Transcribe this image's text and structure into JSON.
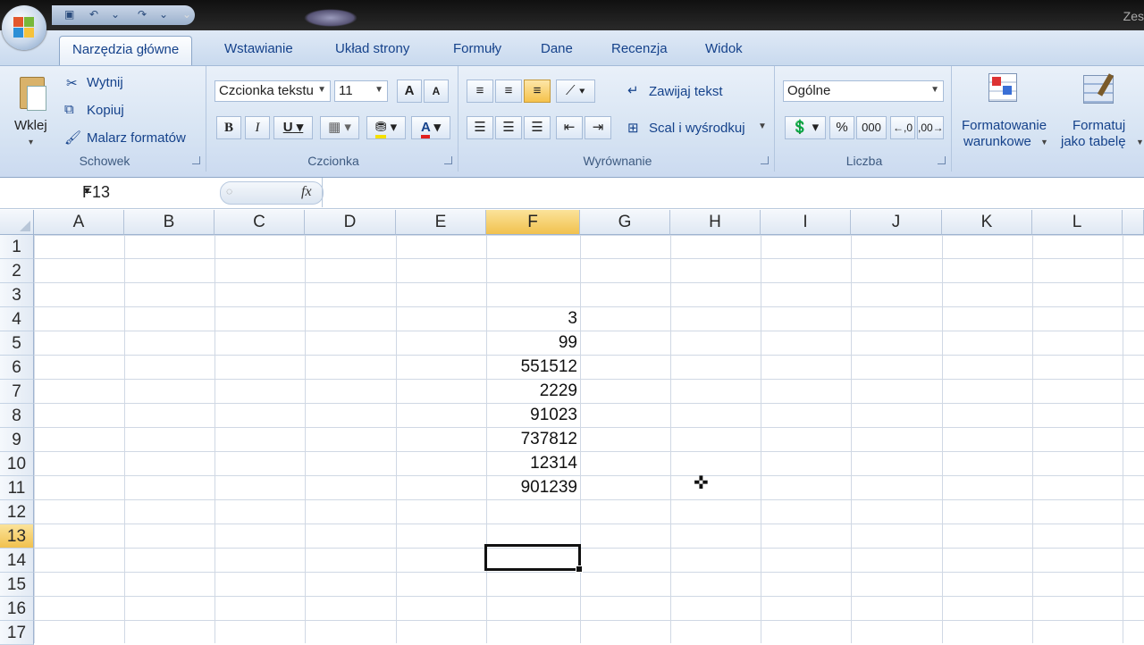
{
  "title": {
    "text": "Zes"
  },
  "tabs": [
    {
      "label": "Narzędzia główne",
      "active": true
    },
    {
      "label": "Wstawianie"
    },
    {
      "label": "Układ strony"
    },
    {
      "label": "Formuły"
    },
    {
      "label": "Dane"
    },
    {
      "label": "Recenzja"
    },
    {
      "label": "Widok"
    }
  ],
  "clipboard": {
    "group": "Schowek",
    "paste": "Wklej",
    "cut": "Wytnij",
    "copy": "Kopiuj",
    "format_painter": "Malarz formatów"
  },
  "font": {
    "group": "Czcionka",
    "name": "Czcionka tekstu",
    "size": "11",
    "bold": "B",
    "italic": "I",
    "underline": "U",
    "grow": "A",
    "shrink": "A",
    "font_color": "A",
    "font_color_hex": "#e02020"
  },
  "alignment": {
    "group": "Wyrównanie",
    "wrap": "Zawijaj tekst",
    "merge": "Scal i wyśrodkuj"
  },
  "number": {
    "group": "Liczba",
    "format": "Ogólne",
    "percent": "%",
    "thousands": "000"
  },
  "styles": {
    "conditional_line1": "Formatowanie",
    "conditional_line2": "warunkowe",
    "table_line1": "Formatuj",
    "table_line2": "jako tabelę"
  },
  "formula_bar": {
    "name_box": "F13",
    "fx": "fx",
    "formula": ""
  },
  "columns": [
    "A",
    "B",
    "C",
    "D",
    "E",
    "F",
    "G",
    "H",
    "I",
    "J",
    "K",
    "L"
  ],
  "selected_column": "F",
  "rows": [
    "1",
    "2",
    "3",
    "4",
    "5",
    "6",
    "7",
    "8",
    "9",
    "10",
    "11",
    "12",
    "13",
    "14",
    "15",
    "16",
    "17"
  ],
  "selected_row": "13",
  "cells": {
    "F4": "3",
    "F5": "99",
    "F6": "551512",
    "F7": "2229",
    "F8": "91023",
    "F9": "737812",
    "F10": "12314",
    "F11": "901239"
  },
  "active_cell": "F13",
  "colors": {
    "accent": "#15428b",
    "selected_header": "#f1c14e"
  }
}
